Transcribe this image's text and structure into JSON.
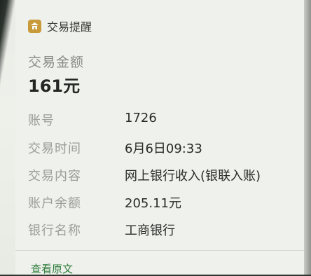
{
  "header": {
    "title": "交易提醒",
    "icon": "bank-icon"
  },
  "amount": {
    "label": "交易金额",
    "value": "161元"
  },
  "details": [
    {
      "label": "账号",
      "value": "1726"
    },
    {
      "label": "交易时间",
      "value": "6月6日09:33"
    },
    {
      "label": "交易内容",
      "value": "网上银行收入(银联入账)"
    },
    {
      "label": "账户余额",
      "value": "205.11元"
    },
    {
      "label": "银行名称",
      "value": "工商银行"
    }
  ],
  "footer": {
    "link": "查看原文"
  },
  "colors": {
    "accent": "#2f7d3c",
    "icon": "#c89a3a"
  }
}
